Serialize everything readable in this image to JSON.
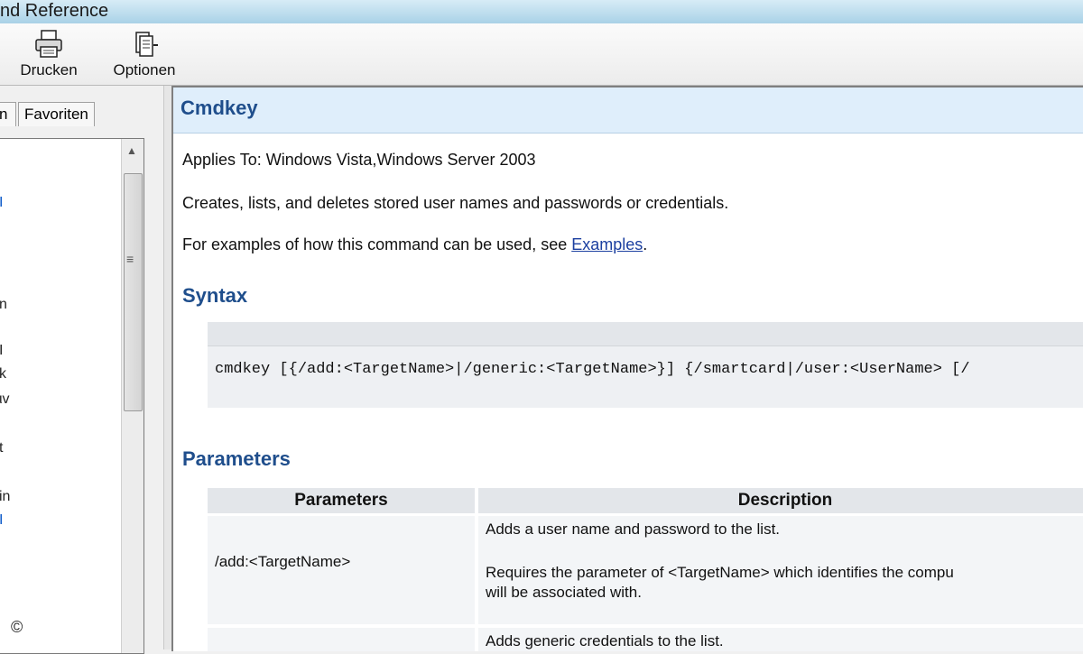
{
  "window": {
    "title": "nd Reference"
  },
  "toolbar": {
    "print_label": "Drucken",
    "options_label": "Optionen"
  },
  "tabs": {
    "partial_tab": "n",
    "favorites": "Favoriten"
  },
  "tree": {
    "items": [
      "I",
      "n",
      "I",
      "k",
      "ιv",
      "t",
      "in",
      "I"
    ]
  },
  "footer": {
    "copyright": "©"
  },
  "content": {
    "title": "Cmdkey",
    "applies_to": "Applies To: Windows Vista,Windows Server 2003",
    "description": "Creates, lists, and deletes stored user names and passwords or credentials.",
    "examples_prefix": "For examples of how this command can be used, see ",
    "examples_link": "Examples",
    "examples_suffix": ".",
    "syntax_heading": "Syntax",
    "syntax_code": "cmdkey [{/add:<TargetName>|/generic:<TargetName>}] {/smartcard|/user:<UserName> [/",
    "parameters_heading": "Parameters",
    "table": {
      "headers": [
        "Parameters",
        "Description"
      ],
      "rows": [
        {
          "param": "/add:<TargetName>",
          "desc1": "Adds a user name and password to the list.",
          "desc2": "Requires the parameter of <TargetName> which identifies the compu",
          "desc3": "will be associated with."
        },
        {
          "param": "",
          "desc1": "Adds generic credentials to the list."
        }
      ]
    }
  }
}
